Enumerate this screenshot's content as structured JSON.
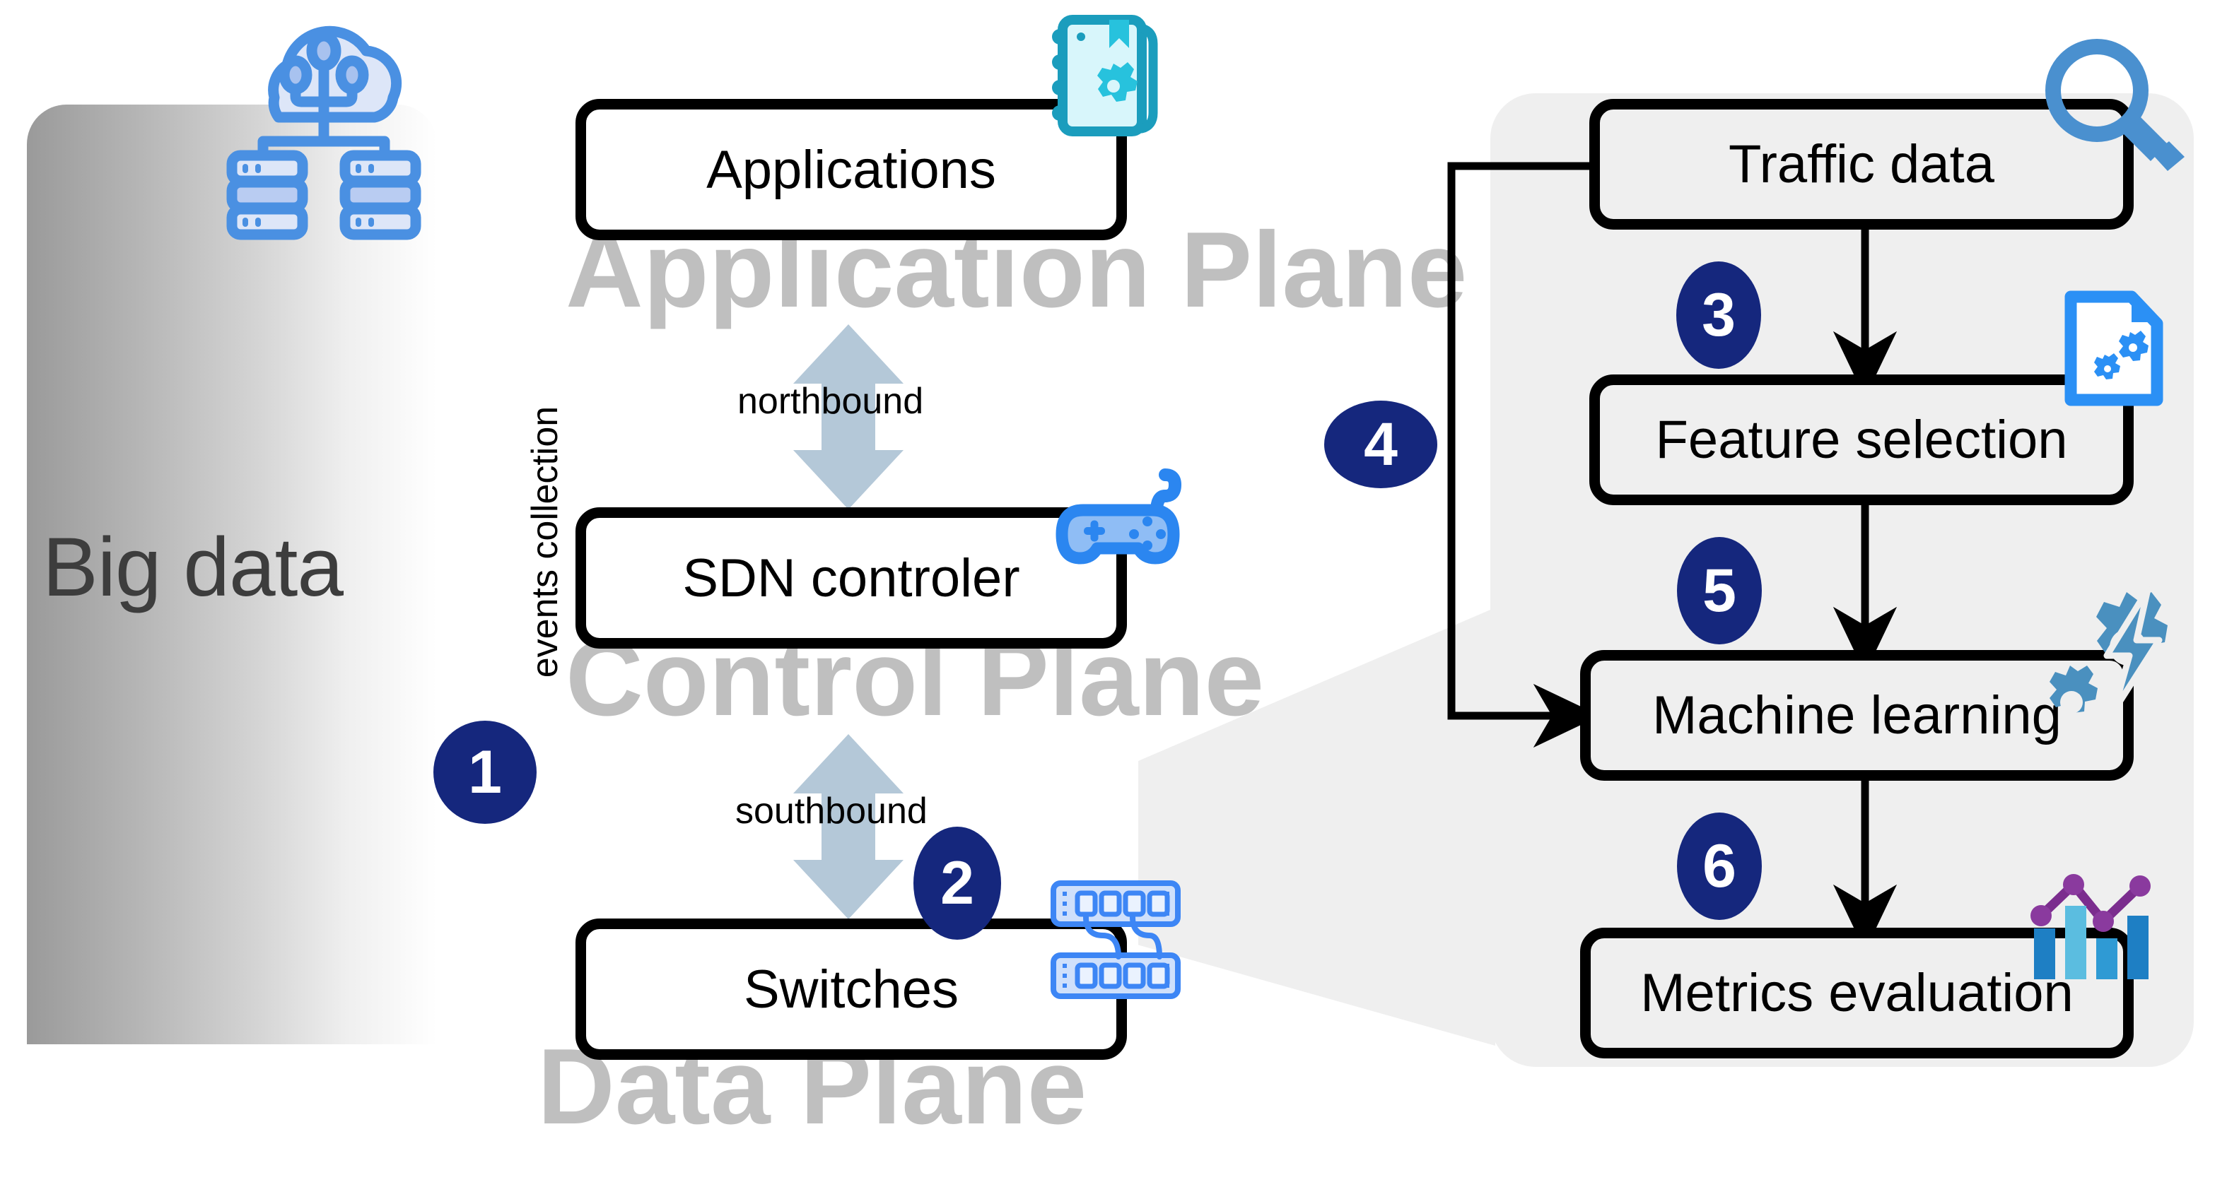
{
  "diagram": {
    "title_hidden": "",
    "planes": [
      {
        "key": "application",
        "label": "Application Plane"
      },
      {
        "key": "control",
        "label": "Control Plane"
      },
      {
        "key": "data",
        "label": "Data Plane"
      }
    ],
    "bigdata": {
      "label": "Big data",
      "icon": "cloud-network-database-icon"
    },
    "events_label": "events collection",
    "interfaces": [
      {
        "key": "northbound",
        "label": "northbound"
      },
      {
        "key": "southbound",
        "label": "southbound"
      }
    ],
    "sdn_boxes": [
      {
        "key": "applications",
        "label": "Applications",
        "icon": "notebook-gear-icon"
      },
      {
        "key": "sdn-controler",
        "label": "SDN controler",
        "icon": "gamepad-icon"
      },
      {
        "key": "switches",
        "label": "Switches",
        "icon": "network-switch-icon"
      }
    ],
    "pipeline_boxes": [
      {
        "key": "traffic-data",
        "label": "Traffic data",
        "icon": "magnifier-icon"
      },
      {
        "key": "feature-selection",
        "label": "Feature selection",
        "icon": "document-gears-icon"
      },
      {
        "key": "machine-learning",
        "label": "Machine learning",
        "icon": "gear-lightning-icon"
      },
      {
        "key": "metrics-evaluation",
        "label": "Metrics evaluation",
        "icon": "bar-line-chart-icon"
      }
    ],
    "step_badges": [
      {
        "n": "1",
        "describes": "events collection from big data"
      },
      {
        "n": "2",
        "describes": "switches to analytics pipeline"
      },
      {
        "n": "3",
        "describes": "traffic data to feature selection"
      },
      {
        "n": "4",
        "describes": "traffic data feedback to machine learning"
      },
      {
        "n": "5",
        "describes": "feature selection to machine learning"
      },
      {
        "n": "6",
        "describes": "machine learning to metrics evaluation"
      }
    ],
    "colors": {
      "badge_navy": "#15277d",
      "watermark_gray": "#bfbfbf",
      "panel_gray": "#efefef",
      "arrow_steel": "#b4c8d8",
      "accent_blue": "#4a90e2",
      "accent_teal": "#1b9dbd",
      "bigdata_text": "#3d3d3d",
      "chart_purple": "#7b2d8e",
      "stroke_black": "#000000"
    }
  }
}
